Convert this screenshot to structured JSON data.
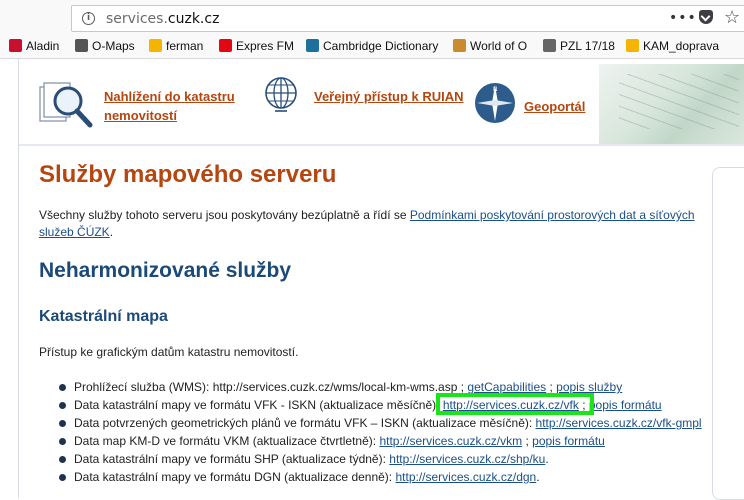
{
  "browser": {
    "url_host_prefix": "services.",
    "url_host_domain": "cuzk.cz",
    "page_actions_label": "•••",
    "bookmarks": [
      {
        "label": "Aladin",
        "icon": "aladin-icon",
        "color": "#c8102e"
      },
      {
        "label": "O-Maps",
        "icon": "wikipedia-icon",
        "color": "#555555"
      },
      {
        "label": "ferman",
        "icon": "drive-icon",
        "color": "#f4b400"
      },
      {
        "label": "Expres FM",
        "icon": "expres-fm-icon",
        "color": "#e30613"
      },
      {
        "label": "Cambridge Dictionary",
        "icon": "cambridge-icon",
        "color": "#1d6f9e"
      },
      {
        "label": "World of O",
        "icon": "world-of-o-icon",
        "color": "#c98b2e"
      },
      {
        "label": "PZL 17/18",
        "icon": "globe-icon",
        "color": "#666666"
      },
      {
        "label": "KAM_doprava",
        "icon": "drive-icon",
        "color": "#f4b400"
      }
    ]
  },
  "header": {
    "link1_line1": "Nahlížení do katastru",
    "link1_line2": "nemovitostí",
    "link2": "Veřejný přístup k RUIAN",
    "link3": "Geoportál"
  },
  "main": {
    "title": "Služby mapového serveru",
    "intro_text": "Všechny služby tohoto serveru jsou poskytovány bezúplatně a řídí se ",
    "intro_link_line1": "Podmínkami poskytování prostorových dat a síťových",
    "intro_link_line2": "služeb ČÚZK",
    "intro_end": ".",
    "h2": "Neharmonizované služby",
    "h3": "Katastrální mapa",
    "access_text": "Přístup ke grafickým datům katastru nemovitostí.",
    "services": [
      {
        "text": "Prohlížecí služba (WMS): http://services.cuzk.cz/wms/local-km-wms.asp ; ",
        "link1": "getCapabilities",
        "sep": " ; ",
        "link2": "popis služby",
        "end": ""
      },
      {
        "text": "Data katastrální mapy ve formátu VFK - ISKN (aktualizace měsíčně): ",
        "link1": "http://services.cuzk.cz/vfk",
        "sep": " ; ",
        "link2": "popis formátu",
        "end": ""
      },
      {
        "text": "Data potvrzených geometrických plánů ve formátu VFK – ISKN (aktualizace měsíčně): ",
        "link1": "http://services.cuzk.cz/vfk-gmpl",
        "sep": "",
        "link2": "",
        "end": ""
      },
      {
        "text": "Data map KM-D ve formátu VKM (aktualizace čtvrtletně): ",
        "link1": "http://services.cuzk.cz/vkm",
        "sep": " ; ",
        "link2": "popis formátu",
        "end": ""
      },
      {
        "text": "Data katastrální mapy ve formátu SHP (aktualizace týdně): ",
        "link1": "http://services.cuzk.cz/shp/ku",
        "sep": "",
        "link2": "",
        "end": "."
      },
      {
        "text": "Data katastrální mapy ve formátu DGN (aktualizace denně): ",
        "link1": "http://services.cuzk.cz/dgn",
        "sep": "",
        "link2": "",
        "end": "."
      }
    ]
  },
  "colors": {
    "accent_orange": "#b5460f",
    "heading_blue": "#1c4a78",
    "link_blue": "#1a4f8a",
    "highlight_green": "#19e619"
  }
}
